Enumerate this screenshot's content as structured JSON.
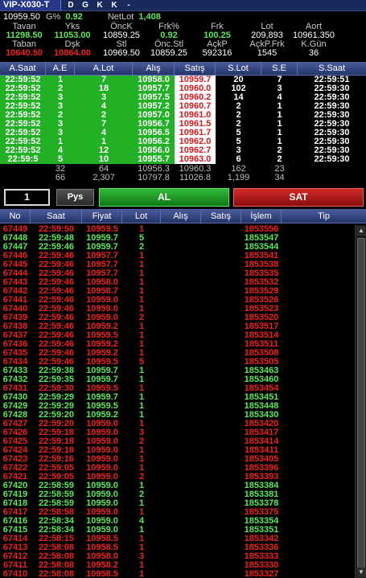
{
  "window": {
    "symbol": "VIP-X030-T",
    "buttons": [
      "D",
      "G",
      "K",
      "K",
      "-"
    ]
  },
  "summary": {
    "last_price": "10959.50",
    "g_label": "G%",
    "g_value": "0.92",
    "netlot_label": "NetLot",
    "netlot_value": "1,408",
    "columns": [
      {
        "label": "Tavan",
        "value": "11298.50",
        "label2": "Taban",
        "value2": "10640.50"
      },
      {
        "label": "Yks",
        "value": "11053.00",
        "label2": "Dşk",
        "value2": "10864.00"
      },
      {
        "label": "ÖncK",
        "value": "10859.25",
        "label2": "Stl",
        "value2": "10969.50"
      },
      {
        "label": "Frk%",
        "value": "0.92",
        "label2": "Önc.Stl",
        "value2": "10859.25"
      },
      {
        "label": "Frk",
        "value": "100.25",
        "label2": "AçkP",
        "value2": "592316"
      },
      {
        "label": "Lot",
        "value": "209,893",
        "label2": "AçkP.Frk",
        "value2": "1545"
      },
      {
        "label": "Aort",
        "value": "10961.350",
        "label2": "K.Gün",
        "value2": "36"
      }
    ]
  },
  "depth": {
    "headers": [
      "A.Saat",
      "A.E",
      "A.Lot",
      "Alış",
      "Satış",
      "S.Lot",
      "S.E",
      "S.Saat"
    ],
    "rows": [
      [
        "22:59:52",
        "1",
        "7",
        "10958.0",
        "10959.7",
        "20",
        "7",
        "22:59:51"
      ],
      [
        "22:59:52",
        "2",
        "18",
        "10957.7",
        "10960.0",
        "102",
        "3",
        "22:59:30"
      ],
      [
        "22:59:52",
        "3",
        "3",
        "10957.5",
        "10960.2",
        "14",
        "4",
        "22:59:30"
      ],
      [
        "22:59:52",
        "3",
        "4",
        "10957.2",
        "10960.7",
        "2",
        "1",
        "22:59:30"
      ],
      [
        "22:59:52",
        "2",
        "2",
        "10957.0",
        "10961.0",
        "2",
        "1",
        "22:59:30"
      ],
      [
        "22:59:52",
        "3",
        "7",
        "10956.7",
        "10961.5",
        "2",
        "1",
        "22:59:30"
      ],
      [
        "22:59:52",
        "3",
        "4",
        "10956.5",
        "10961.7",
        "5",
        "1",
        "22:59:30"
      ],
      [
        "22:59:52",
        "1",
        "1",
        "10956.2",
        "10962.0",
        "5",
        "1",
        "22:59:30"
      ],
      [
        "22:59:52",
        "4",
        "12",
        "10956.0",
        "10962.7",
        "3",
        "2",
        "22:59:30"
      ],
      [
        "22:59:5",
        "5",
        "10",
        "10955.7",
        "10963.0",
        "6",
        "2",
        "22:59:30"
      ]
    ],
    "totals": [
      [
        "",
        "32",
        "64",
        "10956.3",
        "10960.3",
        "162",
        "23",
        ""
      ],
      [
        "",
        "66",
        "2,307",
        "10797.8",
        "11026.8",
        "1,199",
        "34",
        ""
      ]
    ]
  },
  "order": {
    "quantity": "1",
    "pys_label": "Pys",
    "buy_label": "AL",
    "sell_label": "SAT"
  },
  "trades": {
    "headers": [
      "No",
      "Saat",
      "Fiyat",
      "Lot",
      "Alış",
      "Satış",
      "İşlem",
      "Tip"
    ],
    "rows": [
      [
        "67449",
        "22:59:50",
        "10959.5",
        "1",
        "",
        "",
        "1853556",
        "",
        "sell"
      ],
      [
        "67448",
        "22:59:48",
        "10959.7",
        "5",
        "",
        "",
        "1853547",
        "",
        "buy"
      ],
      [
        "67447",
        "22:59:46",
        "10959.7",
        "2",
        "",
        "",
        "1853544",
        "",
        "buy"
      ],
      [
        "67446",
        "22:59:46",
        "10957.7",
        "1",
        "",
        "",
        "1853541",
        "",
        "sell"
      ],
      [
        "67445",
        "22:59:46",
        "10957.7",
        "1",
        "",
        "",
        "1853538",
        "",
        "sell"
      ],
      [
        "67444",
        "22:59:46",
        "10957.7",
        "1",
        "",
        "",
        "1853535",
        "",
        "sell"
      ],
      [
        "67443",
        "22:59:46",
        "10958.0",
        "1",
        "",
        "",
        "1853532",
        "",
        "sell"
      ],
      [
        "67442",
        "22:59:46",
        "10958.7",
        "1",
        "",
        "",
        "1853529",
        "",
        "sell"
      ],
      [
        "67441",
        "22:59:46",
        "10959.0",
        "1",
        "",
        "",
        "1853526",
        "",
        "sell"
      ],
      [
        "67440",
        "22:59:46",
        "10959.0",
        "1",
        "",
        "",
        "1853523",
        "",
        "sell"
      ],
      [
        "67439",
        "22:59:46",
        "10959.0",
        "2",
        "",
        "",
        "1853520",
        "",
        "sell"
      ],
      [
        "67438",
        "22:59:46",
        "10959.2",
        "1",
        "",
        "",
        "1853517",
        "",
        "sell"
      ],
      [
        "67437",
        "22:59:46",
        "10959.5",
        "1",
        "",
        "",
        "1853514",
        "",
        "sell"
      ],
      [
        "67436",
        "22:59:46",
        "10959.2",
        "1",
        "",
        "",
        "1853511",
        "",
        "sell"
      ],
      [
        "67435",
        "22:59:46",
        "10959.2",
        "1",
        "",
        "",
        "1853508",
        "",
        "sell"
      ],
      [
        "67434",
        "22:59:46",
        "10959.5",
        "5",
        "",
        "",
        "1853505",
        "",
        "sell"
      ],
      [
        "67433",
        "22:59:38",
        "10959.7",
        "1",
        "",
        "",
        "1853463",
        "",
        "buy"
      ],
      [
        "67432",
        "22:59:35",
        "10959.7",
        "1",
        "",
        "",
        "1853460",
        "",
        "buy"
      ],
      [
        "67431",
        "22:59:30",
        "10959.5",
        "1",
        "",
        "",
        "1853454",
        "",
        "sell"
      ],
      [
        "67430",
        "22:59:29",
        "10959.7",
        "1",
        "",
        "",
        "1853451",
        "",
        "buy"
      ],
      [
        "67429",
        "22:59:29",
        "10959.5",
        "1",
        "",
        "",
        "1853448",
        "",
        "buy"
      ],
      [
        "67428",
        "22:59:20",
        "10959.2",
        "1",
        "",
        "",
        "1853430",
        "",
        "buy"
      ],
      [
        "67427",
        "22:59:20",
        "10959.0",
        "1",
        "",
        "",
        "1853420",
        "",
        "sell"
      ],
      [
        "67426",
        "22:59:18",
        "10959.0",
        "3",
        "",
        "",
        "1853417",
        "",
        "sell"
      ],
      [
        "67425",
        "22:59:18",
        "10959.0",
        "2",
        "",
        "",
        "1853414",
        "",
        "sell"
      ],
      [
        "67424",
        "22:59:18",
        "10959.0",
        "1",
        "",
        "",
        "1853411",
        "",
        "sell"
      ],
      [
        "67423",
        "22:59:16",
        "10959.0",
        "1",
        "",
        "",
        "1853405",
        "",
        "sell"
      ],
      [
        "67422",
        "22:59:05",
        "10959.0",
        "1",
        "",
        "",
        "1853396",
        "",
        "sell"
      ],
      [
        "67421",
        "22:59:05",
        "10959.0",
        "2",
        "",
        "",
        "1853393",
        "",
        "sell"
      ],
      [
        "67420",
        "22:58:59",
        "10959.0",
        "1",
        "",
        "",
        "1853384",
        "",
        "buy"
      ],
      [
        "67419",
        "22:58:59",
        "10959.0",
        "2",
        "",
        "",
        "1853381",
        "",
        "buy"
      ],
      [
        "67418",
        "22:58:59",
        "10959.0",
        "1",
        "",
        "",
        "1853378",
        "",
        "buy"
      ],
      [
        "67417",
        "22:58:58",
        "10959.0",
        "1",
        "",
        "",
        "1853375",
        "",
        "sell"
      ],
      [
        "67416",
        "22:58:34",
        "10959.0",
        "4",
        "",
        "",
        "1853354",
        "",
        "buy"
      ],
      [
        "67415",
        "22:58:34",
        "10959.0",
        "1",
        "",
        "",
        "1853351",
        "",
        "buy"
      ],
      [
        "67414",
        "22:58:15",
        "10958.5",
        "1",
        "",
        "",
        "1853342",
        "",
        "sell"
      ],
      [
        "67413",
        "22:58:08",
        "10958.5",
        "1",
        "",
        "",
        "1853336",
        "",
        "sell"
      ],
      [
        "67412",
        "22:58:08",
        "10958.0",
        "3",
        "",
        "",
        "1853333",
        "",
        "sell"
      ],
      [
        "67411",
        "22:58:08",
        "10958.2",
        "1",
        "",
        "",
        "1853330",
        "",
        "sell"
      ],
      [
        "67410",
        "22:58:08",
        "10958.5",
        "1",
        "",
        "",
        "1853327",
        "",
        "sell"
      ]
    ]
  },
  "colors": {
    "buy": "#58e858",
    "sell": "#f21d1d",
    "bid_bg": "#22b024",
    "ask_bg": "#ffffff"
  },
  "icons": {
    "scroll_up": "triangle-up-icon",
    "scroll_down": "triangle-down-icon"
  }
}
